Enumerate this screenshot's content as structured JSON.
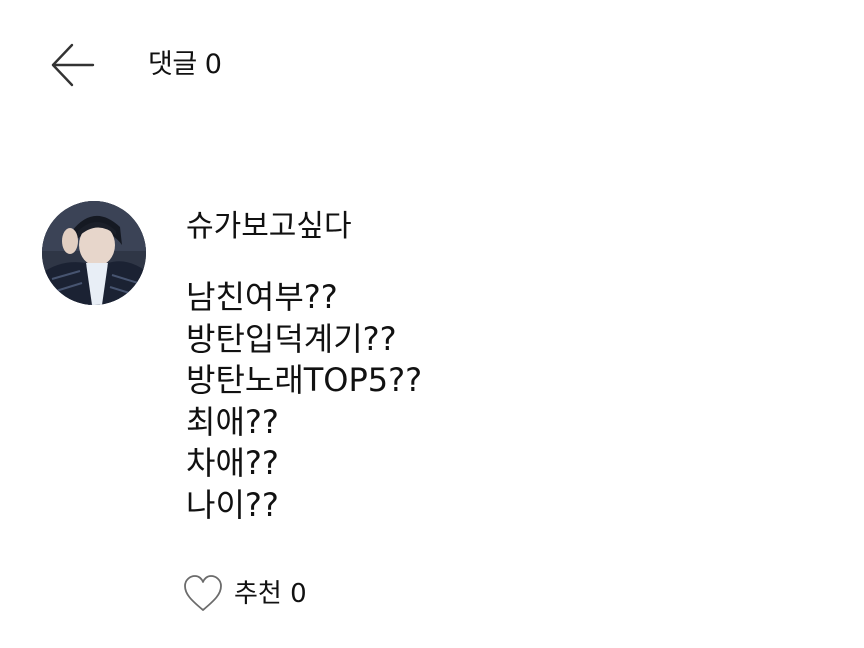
{
  "header": {
    "back_icon": "arrow-left-icon",
    "title": "댓글 0"
  },
  "comment": {
    "avatar_icon": "profile-photo",
    "author": "슈가보고싶다",
    "lines": [
      "남친여부??",
      "방탄입덕계기??",
      "방탄노래TOP5??",
      "최애??",
      "차애??",
      "나이??"
    ],
    "like_icon": "heart-outline-icon",
    "like_label": "추천 0"
  },
  "colors": {
    "background": "#ffffff",
    "text": "#111111",
    "icon_stroke": "#333333",
    "heart_stroke": "#6b6b6b"
  }
}
